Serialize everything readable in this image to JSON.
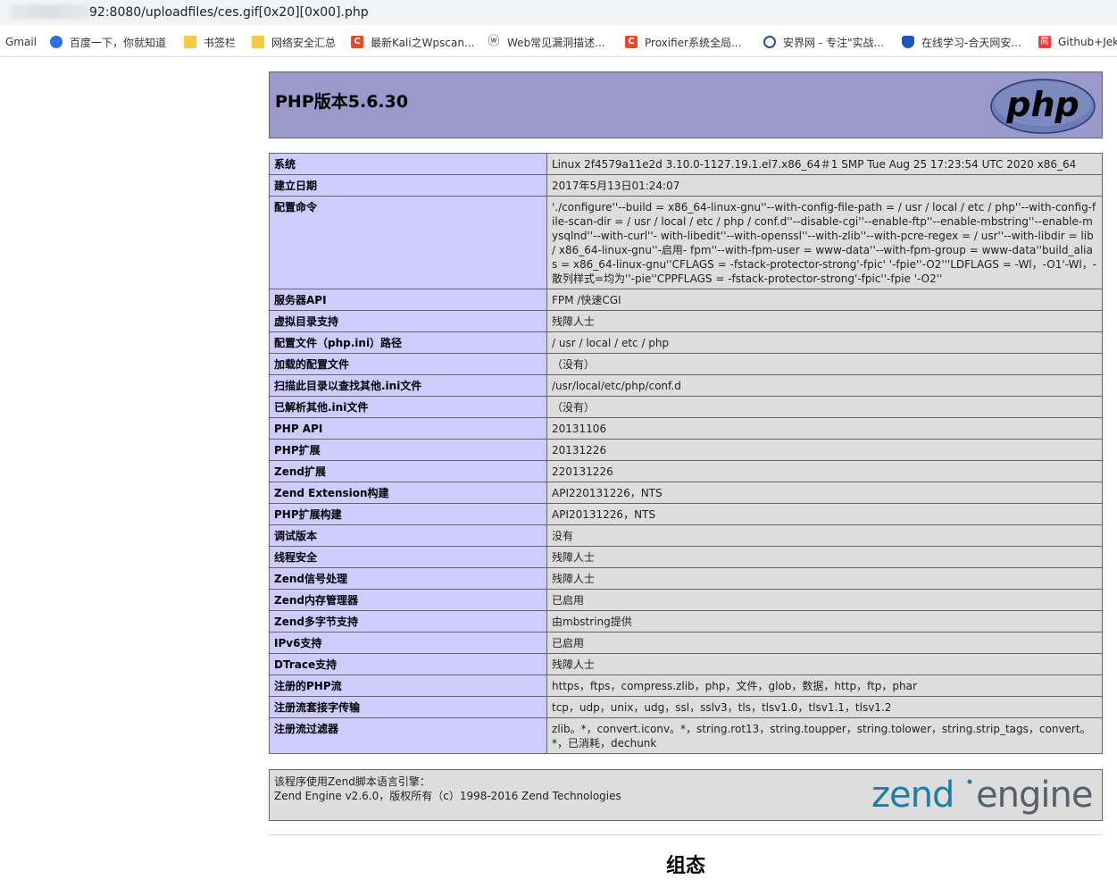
{
  "browser": {
    "url": "92:8080/uploadfiles/ces.gif[0x20][0x00].php",
    "bookmarks": [
      {
        "label": "Gmail",
        "icon": "none"
      },
      {
        "label": "百度一下，你就知道",
        "icon": "baidu-icon"
      },
      {
        "label": "书签栏",
        "icon": "folder-icon"
      },
      {
        "label": "网络安全汇总",
        "icon": "folder-icon"
      },
      {
        "label": "最新Kali之Wpscan...",
        "icon": "csdn-icon"
      },
      {
        "label": "Web常见漏洞描述...",
        "icon": "wvs-icon"
      },
      {
        "label": "Proxifier系统全局...",
        "icon": "csdn-icon"
      },
      {
        "label": "安界网 - 专注\"实战...",
        "icon": "anjie-icon"
      },
      {
        "label": "在线学习-合天网安...",
        "icon": "shield-icon"
      },
      {
        "label": "Github+Jek",
        "icon": "jianshu-icon"
      }
    ]
  },
  "phpinfo": {
    "title": "PHP版本5.6.30",
    "logo_text": "php",
    "rows": [
      {
        "key": "系统",
        "value": "Linux 2f4579a11e2d 3.10.0-1127.19.1.el7.x86_64＃1 SMP Tue Aug 25 17:23:54 UTC 2020 x86_64"
      },
      {
        "key": "建立日期",
        "value": "2017年5月13日01:24:07"
      },
      {
        "key": "配置命令",
        "value": "'./configure''--build = x86_64-linux-gnu''--with-config-file-path = / usr / local / etc / php''--with-config-file-scan-dir = / usr / local / etc / php / conf.d''--disable-cgi''--enable-ftp''--enable-mbstring''--enable-mysqlnd''--with-curl''- with-libedit''--with-openssl''--with-zlib''--with-pcre-regex = / usr''--with-libdir = lib / x86_64-linux-gnu''-启用- fpm''--with-fpm-user = www-data''--with-fpm-group = www-data''build_alias = x86_64-linux-gnu''CFLAGS = -fstack-protector-strong'-fpic' '-fpie''-O2'''LDFLAGS = -Wl，-O1'-Wl，-散列样式=均为''-pie''CPPFLAGS = -fstack-protector-strong'-fpic''-fpie '-O2''"
      },
      {
        "key": "服务器API",
        "value": "FPM /快速CGI"
      },
      {
        "key": "虚拟目录支持",
        "value": "残障人士"
      },
      {
        "key": "配置文件（php.ini）路径",
        "value": "/ usr / local / etc / php"
      },
      {
        "key": "加载的配置文件",
        "value": "（没有）"
      },
      {
        "key": "扫描此目录以查找其他.ini文件",
        "value": "/usr/local/etc/php/conf.d"
      },
      {
        "key": "已解析其他.ini文件",
        "value": "（没有）"
      },
      {
        "key": "PHP API",
        "value": "20131106"
      },
      {
        "key": "PHP扩展",
        "value": "20131226"
      },
      {
        "key": "Zend扩展",
        "value": "220131226"
      },
      {
        "key": "Zend Extension构建",
        "value": "API220131226，NTS"
      },
      {
        "key": "PHP扩展构建",
        "value": "API20131226，NTS"
      },
      {
        "key": "调试版本",
        "value": "没有"
      },
      {
        "key": "线程安全",
        "value": "残障人士"
      },
      {
        "key": "Zend信号处理",
        "value": "残障人士"
      },
      {
        "key": "Zend内存管理器",
        "value": "已启用"
      },
      {
        "key": "Zend多字节支持",
        "value": "由mbstring提供"
      },
      {
        "key": "IPv6支持",
        "value": "已启用"
      },
      {
        "key": "DTrace支持",
        "value": "残障人士"
      },
      {
        "key": "注册的PHP流",
        "value": "https，ftps，compress.zlib，php，文件，glob，数据，http，ftp，phar"
      },
      {
        "key": "注册流套接字传输",
        "value": "tcp，udp，unix，udg，ssl，sslv3，tls，tlsv1.0，tlsv1.1，tlsv1.2"
      },
      {
        "key": "注册流过滤器",
        "value": "zlib。*，convert.iconv。*，string.rot13，string.toupper，string.tolower，string.strip_tags，convert。*，已消耗，dechunk"
      }
    ],
    "zend": {
      "line1": "该程序使用Zend脚本语言引擎：",
      "line2": "Zend Engine v2.6.0，版权所有（c）1998-2016 Zend Technologies",
      "logo_word1": "zend",
      "logo_word2": "engine"
    },
    "next_section": "组态"
  },
  "colors": {
    "header_bg": "#9999cc",
    "key_bg": "#ccccff",
    "value_bg": "#dddddd",
    "zend_teal": "#1f7ea6",
    "zend_grey": "#5a6068"
  }
}
